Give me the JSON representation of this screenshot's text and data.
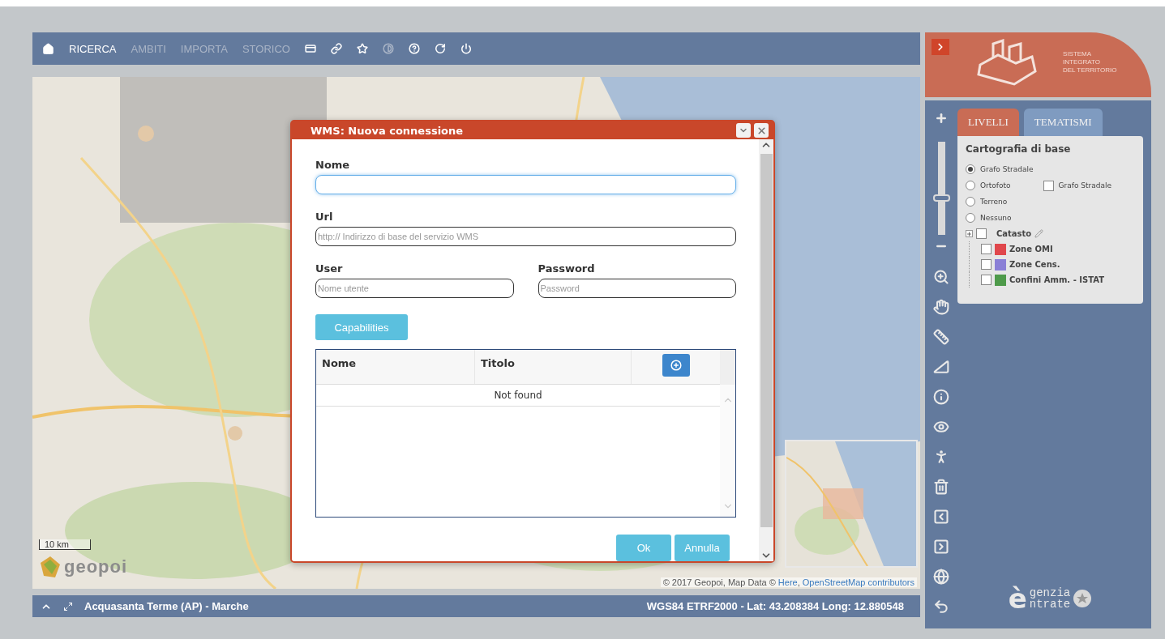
{
  "toolbar": {
    "nav": [
      {
        "label": "RICERCA",
        "selected": true,
        "disabled": false
      },
      {
        "label": "AMBITI",
        "selected": false,
        "disabled": true
      },
      {
        "label": "IMPORTA",
        "selected": false,
        "disabled": true
      },
      {
        "label": "STORICO",
        "selected": false,
        "disabled": true
      }
    ]
  },
  "map": {
    "scale": "10 km",
    "logo": "geopoi",
    "attribution": "© 2017 Geopoi, Map Data © ",
    "attribution_links": [
      "Here",
      "OpenStreetMap contributors"
    ],
    "attribution_separator": ", "
  },
  "dialog": {
    "title": "WMS: Nuova connessione",
    "fields": [
      {
        "label": "Nome",
        "focused": true
      },
      {
        "label": "Url",
        "placeholder": "http:// Indirizzo di base del servizio WMS",
        "focused": false
      },
      {
        "label": "User",
        "placeholder": "Nome utente",
        "focused": false
      },
      {
        "label": "Password",
        "placeholder": "Password",
        "focused": false
      }
    ],
    "capabilities_button": "Capabilities",
    "table": {
      "columns": [
        "Nome",
        "Titolo"
      ],
      "empty_message": "Not found"
    },
    "buttons": [
      "Ok",
      "Annulla"
    ]
  },
  "status_bar": {
    "location": "Acquasanta Terme (AP) - Marche",
    "coordinates": "WGS84 ETRF2000 - Lat: 43.208384 Long: 12.880548"
  },
  "sidebar": {
    "brand": [
      "SISTEMA",
      "INTEGRATO",
      "DEL TERRITORIO"
    ],
    "zoom": {
      "level": 0.4
    },
    "tabs": [
      {
        "label": "LIVELLI",
        "selected": true
      },
      {
        "label": "TEMATISMI",
        "selected": false
      }
    ],
    "section_title": "Cartografia di base",
    "base_layers": [
      {
        "label": "Grafo Stradale",
        "selected": true
      },
      {
        "label": "Ortofoto",
        "selected": false
      },
      {
        "label": "Terreno",
        "selected": false
      },
      {
        "label": "Nessuno",
        "selected": false
      }
    ],
    "ortofoto_overlay": {
      "label": "Grafo Stradale",
      "checked": false
    },
    "overlays": [
      {
        "label": "Catasto",
        "checked": false,
        "expanded": false,
        "editable": true,
        "children": [
          {
            "label": "Zone OMI",
            "checked": false,
            "color": "#e0474c"
          },
          {
            "label": "Zone Cens.",
            "checked": false,
            "color": "#8a7fd6"
          },
          {
            "label": "Confini Amm. - ISTAT",
            "checked": false,
            "color": "#4e9a4a"
          }
        ]
      }
    ],
    "agency_logo": {
      "initial": "è",
      "lines": [
        "genzia",
        "ntrate"
      ]
    }
  }
}
